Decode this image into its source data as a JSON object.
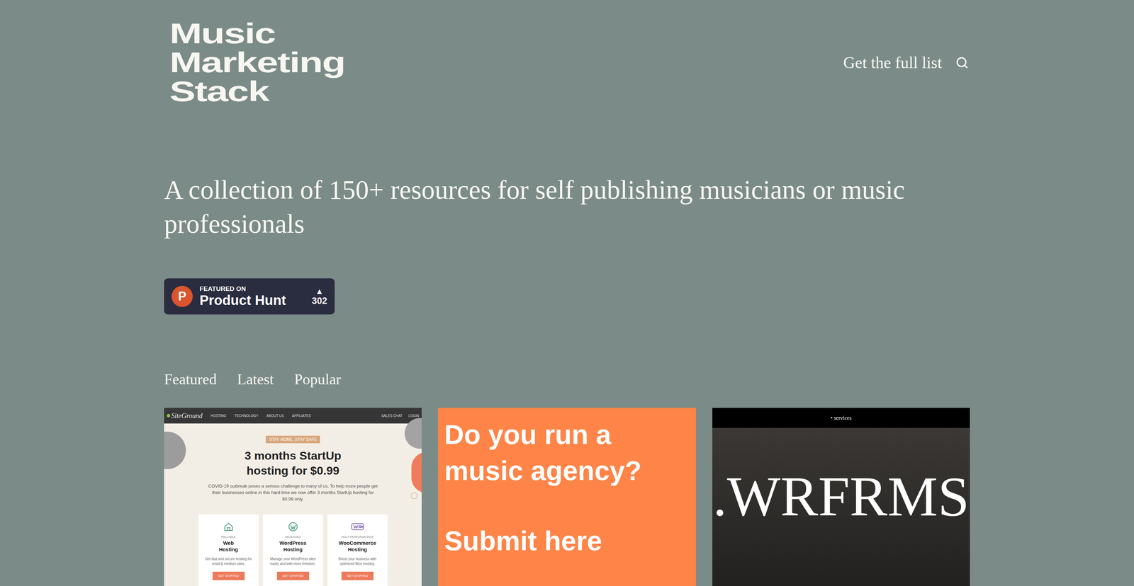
{
  "header": {
    "logo": [
      "Music",
      "Marketing",
      "Stack"
    ],
    "nav_link": "Get the full list"
  },
  "hero": {
    "headline": "A collection of 150+ resources for self publishing musicians or music professionals",
    "badge": {
      "logo_letter": "P",
      "kicker": "FEATURED ON",
      "name": "Product Hunt",
      "arrow": "▲",
      "votes": "302"
    }
  },
  "tabs": [
    {
      "label": "Featured",
      "selected": false
    },
    {
      "label": "Latest",
      "selected": false
    },
    {
      "label": "Popular",
      "selected": false
    }
  ],
  "cards": [
    {
      "kind": "site-screenshot",
      "logo": "SiteGround",
      "nav": [
        "HOSTING",
        "TECHNOLOGY",
        "ABOUT US",
        "AFFILIATES"
      ],
      "nav_right": [
        "SALES CHAT",
        "LOGIN"
      ],
      "badge": "STAY HOME, STAY SAFE",
      "headline": [
        "3 months StartUp",
        "hosting for $0.99"
      ],
      "body": "COVID-19 outbreak poses a serious challenge to many of us. To help more people get their businesses online in this hard time we now offer 3 months StartUp hosting for $0.99 only.",
      "plans": [
        {
          "kicker": "RELIABLE",
          "title": [
            "Web",
            "Hosting"
          ],
          "desc": "Get fast and secure hosting for small & medium sites.",
          "button": "GET STARTED"
        },
        {
          "kicker": "MANAGED",
          "title": [
            "WordPress",
            "Hosting"
          ],
          "desc": "Manage your WordPress sites easily and with more freedom.",
          "button": "GET STARTED"
        },
        {
          "kicker": "HIGH PERFORMANCE",
          "title": [
            "WooCommerce",
            "Hosting"
          ],
          "desc": "Boost your business with optimized Woo hosting.",
          "button": "GET STARTED"
        }
      ]
    },
    {
      "kind": "promo",
      "lines": [
        "Do you run a",
        "music agency?"
      ],
      "cta": "Submit here"
    },
    {
      "kind": "video-frame",
      "caption": "• services",
      "title": ".WRFRMS"
    }
  ]
}
